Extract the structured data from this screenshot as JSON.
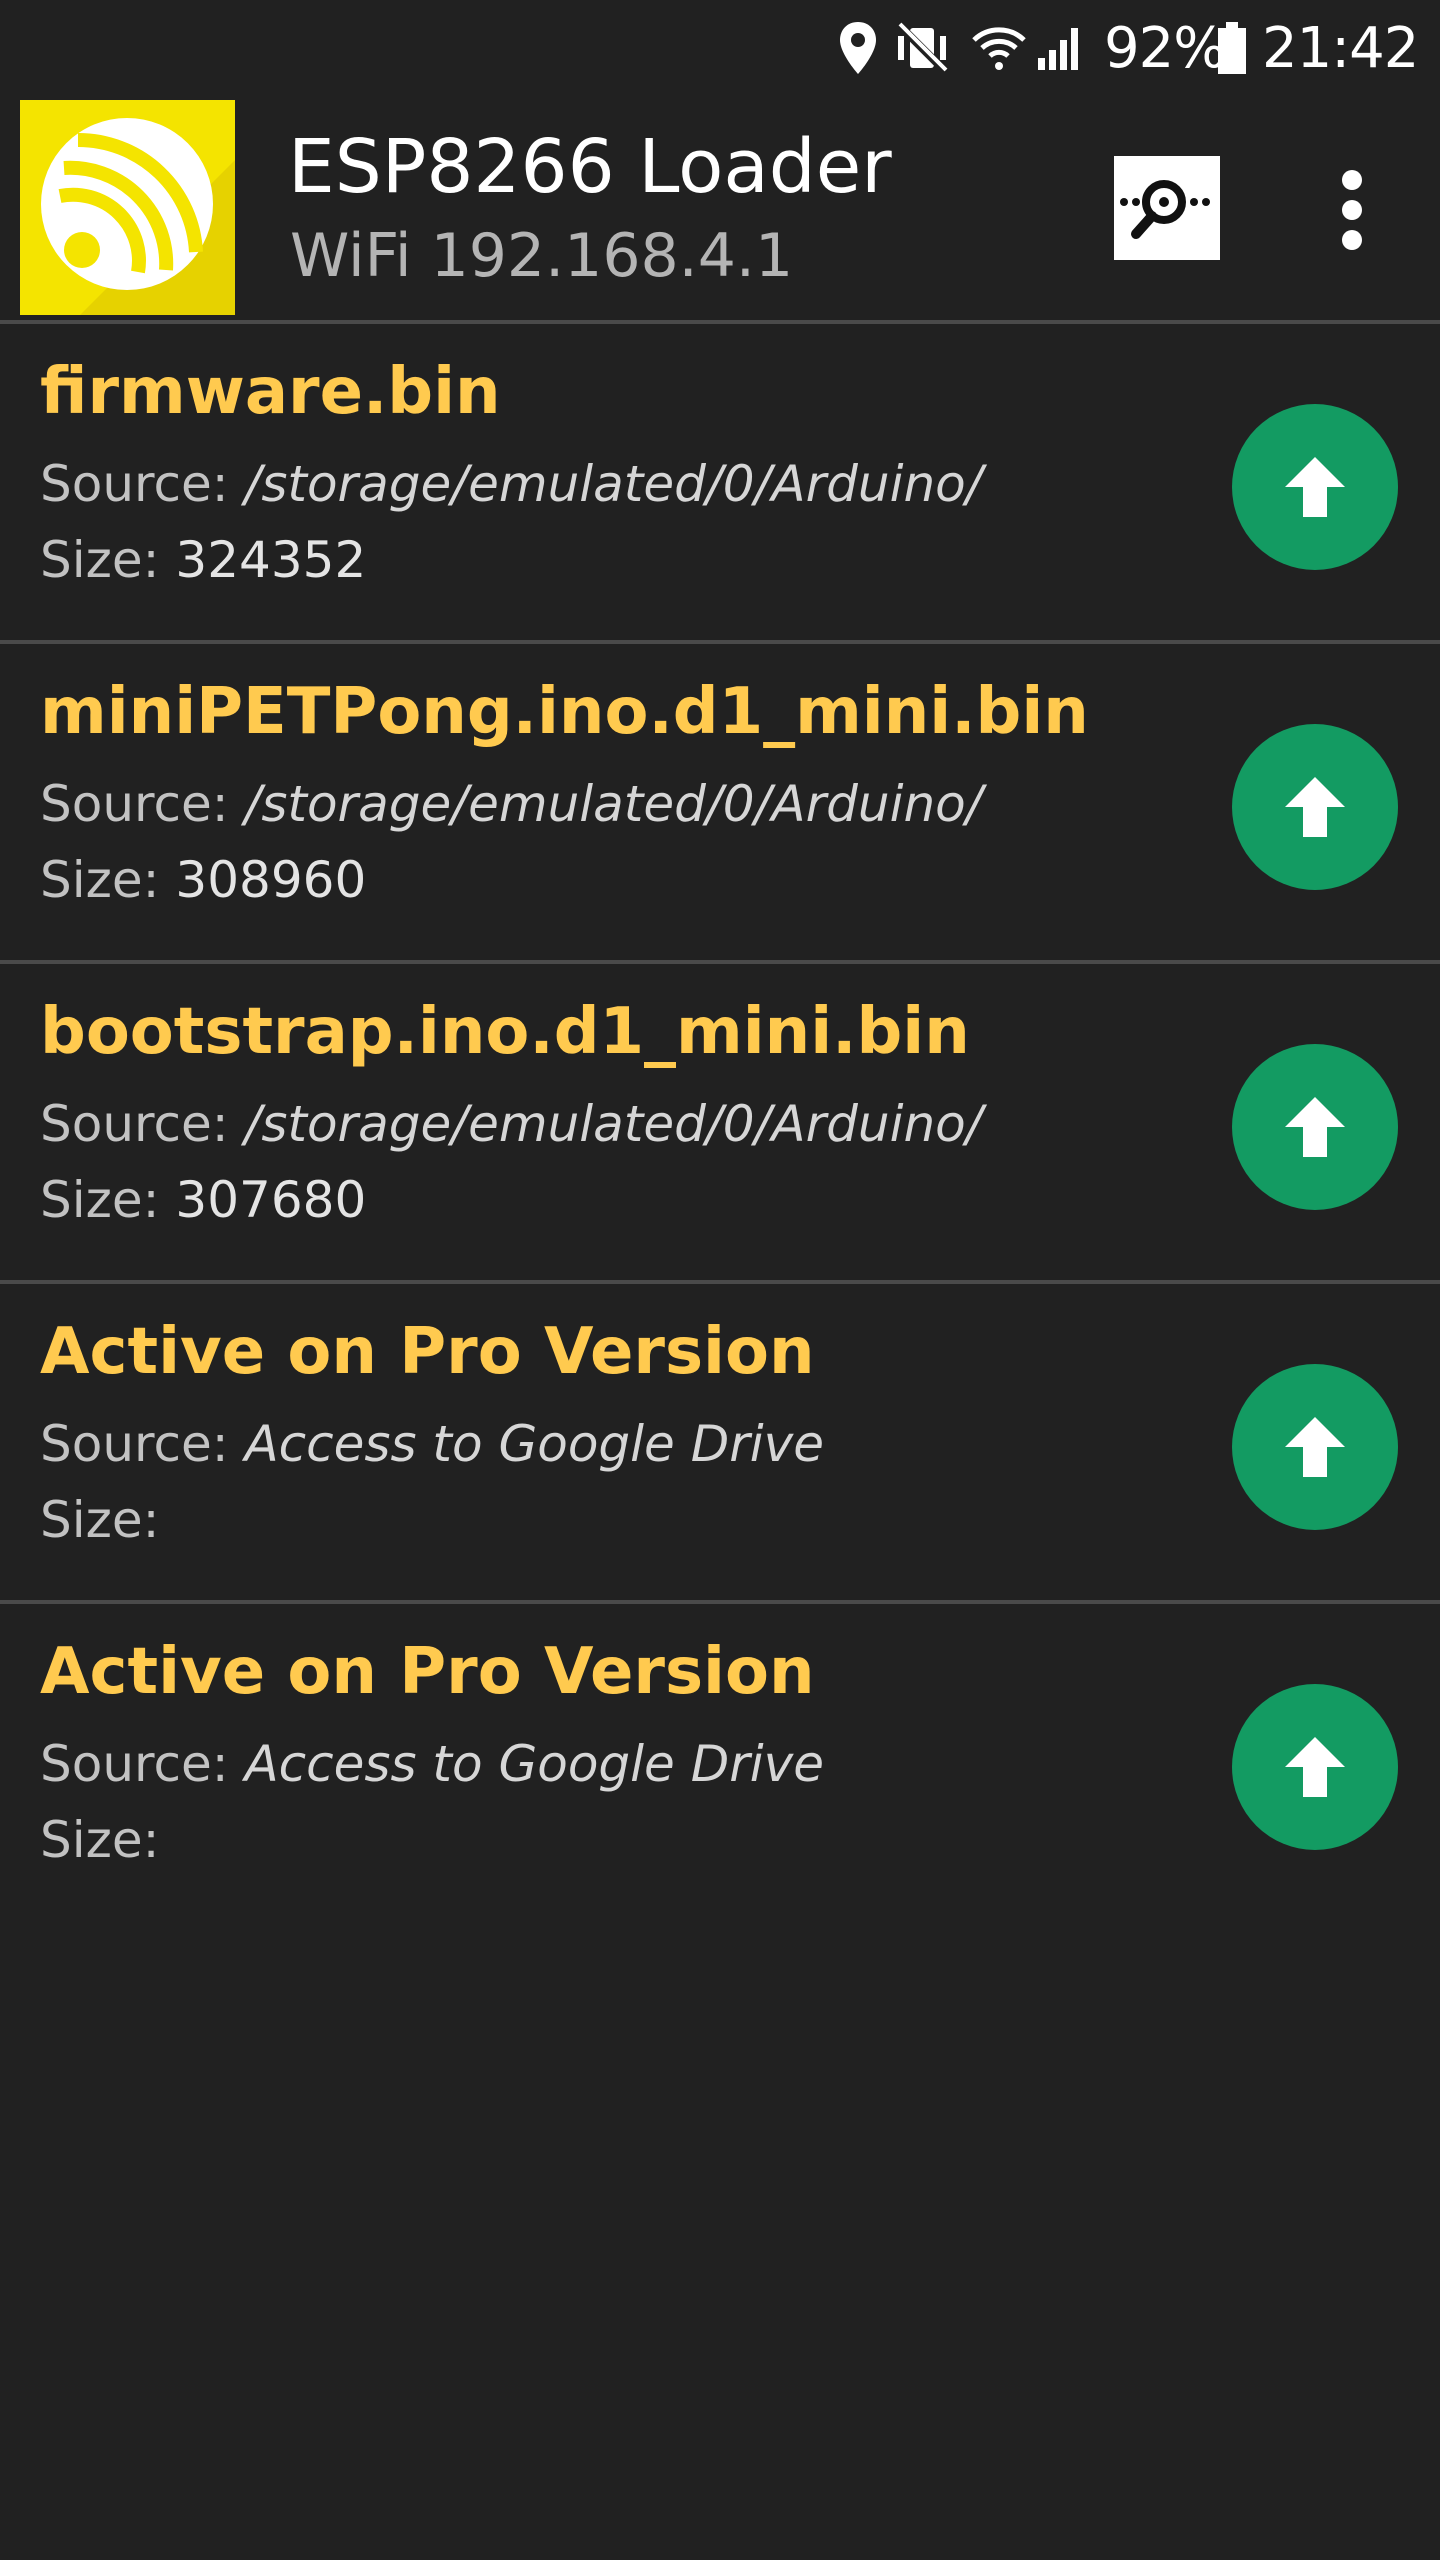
{
  "status_bar": {
    "battery": "92%",
    "time": "21:42",
    "icons": [
      "location-icon",
      "vibrate-mute-icon",
      "wifi-icon",
      "signal-icon",
      "battery-icon"
    ]
  },
  "app_bar": {
    "title": "ESP8266 Loader",
    "subtitle": "WiFi 192.168.4.1",
    "logo_icon": "espressif-logo-icon",
    "scan_icon": "network-scan-icon",
    "menu_icon": "more-vert-icon"
  },
  "files": [
    {
      "name": "firmware.bin",
      "source_label": "Source: ",
      "source": "/storage/emulated/0/Arduino/",
      "size_label": "Size: ",
      "size": "324352"
    },
    {
      "name": "miniPETPong.ino.d1_mini.bin",
      "source_label": "Source: ",
      "source": "/storage/emulated/0/Arduino/",
      "size_label": "Size: ",
      "size": "308960"
    },
    {
      "name": "bootstrap.ino.d1_mini.bin",
      "source_label": "Source: ",
      "source": "/storage/emulated/0/Arduino/",
      "size_label": "Size: ",
      "size": "307680"
    },
    {
      "name": "Active on Pro Version",
      "source_label": "Source: ",
      "source": "Access to Google Drive",
      "size_label": "Size:",
      "size": ""
    },
    {
      "name": "Active on Pro Version",
      "source_label": "Source: ",
      "source": "Access to Google Drive",
      "size_label": "Size:",
      "size": ""
    }
  ],
  "colors": {
    "background": "#212121",
    "file_name": "#ffca4f",
    "upload_button": "#139b62",
    "logo_background": "#f4e400",
    "divider": "#4a4a4a"
  }
}
